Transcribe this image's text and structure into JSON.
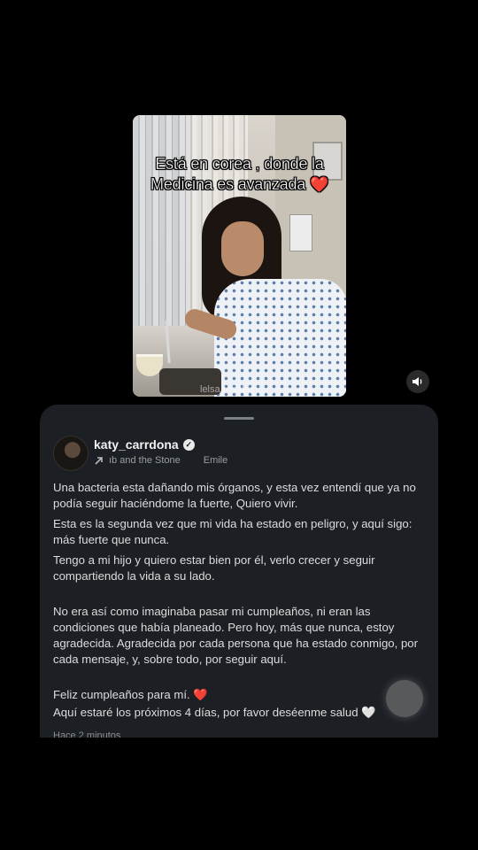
{
  "video": {
    "caption_line1": "Está en corea , donde la",
    "caption_line2": "Medicina es avanzada",
    "caption_emoji": "❤️",
    "watermark": "lelsa.rosales",
    "volume_icon": "speaker-icon"
  },
  "post": {
    "username": "katy_carrdona",
    "verified_icon": "verified-check-icon",
    "music_icon": "arrow-up-right-icon",
    "music_track": "ıb and the Stone",
    "music_artist": "Emile",
    "paragraphs": [
      "Una bacteria esta dañando mis órganos, y esta vez entendí que ya no podía seguir haciéndome la fuerte, Quiero vivir.",
      "Esta es la segunda vez que mi vida ha estado en peligro, y aquí sigo: más fuerte que nunca.",
      "Tengo a mi hijo y quiero estar bien por él, verlo crecer y seguir compartiendo la vida a su lado.",
      "No era así como imaginaba pasar mi cumpleaños, ni eran las condiciones que había planeado. Pero hoy, más que nunca, estoy agradecida. Agradecida por cada persona que ha estado conmigo, por cada mensaje, y, sobre todo, por seguir aquí.",
      "Feliz cumpleaños para mí.",
      "Aquí estaré los próximos 4 días, por favor deséenme salud"
    ],
    "heart_emoji": "❤️",
    "white_heart_emoji": "🤍",
    "timestamp": "Hace 2 minutos"
  },
  "colors": {
    "background": "#000000",
    "sheet": "#1c1f24",
    "heart": "#e0232d"
  }
}
